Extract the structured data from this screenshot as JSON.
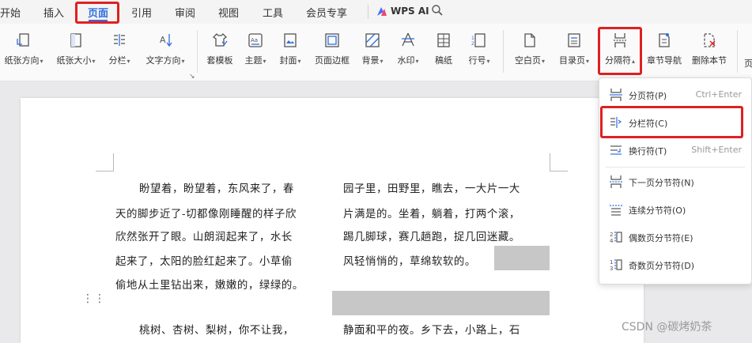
{
  "menubar": {
    "items": [
      "开始",
      "插入",
      "页面",
      "引用",
      "审阅",
      "视图",
      "工具",
      "会员专享"
    ],
    "active": "页面",
    "ai_label": "WPS AI"
  },
  "ribbon": {
    "groups": [
      {
        "label": "纸张方向",
        "icon": "page-orientation-icon",
        "dropdown": true
      },
      {
        "label": "纸张大小",
        "icon": "paper-size-icon",
        "dropdown": true
      },
      {
        "label": "分栏",
        "icon": "columns-icon",
        "dropdown": true
      },
      {
        "label": "文字方向",
        "icon": "text-direction-icon",
        "dropdown": true
      },
      {
        "label": "套模板",
        "icon": "template-shirt-icon",
        "dropdown": false
      },
      {
        "label": "主题",
        "icon": "theme-icon",
        "dropdown": true
      },
      {
        "label": "封面",
        "icon": "cover-page-icon",
        "dropdown": true
      },
      {
        "label": "页面边框",
        "icon": "page-border-icon",
        "dropdown": false
      },
      {
        "label": "背景",
        "icon": "background-icon",
        "dropdown": true
      },
      {
        "label": "水印",
        "icon": "watermark-icon",
        "dropdown": true
      },
      {
        "label": "稿纸",
        "icon": "manuscript-paper-icon",
        "dropdown": false
      },
      {
        "label": "行号",
        "icon": "line-number-icon",
        "dropdown": true
      },
      {
        "label": "空白页",
        "icon": "blank-page-icon",
        "dropdown": true
      },
      {
        "label": "目录页",
        "icon": "toc-page-icon",
        "dropdown": true
      },
      {
        "label": "分隔符",
        "icon": "break-icon",
        "dropdown": true
      },
      {
        "label": "章节导航",
        "icon": "section-nav-icon",
        "dropdown": false
      },
      {
        "label": "删除本节",
        "icon": "delete-section-icon",
        "dropdown": false
      }
    ],
    "edge_char": "页"
  },
  "document": {
    "left_column": [
      "盼望着，盼望着，东风来了，春",
      "天的脚步近了-切都像刚睡醒的样子欣",
      "欣然张开了眼。山朗润起来了，水长",
      "起来了，太阳的脸红起来了。小草偷",
      "偷地从土里钻出来，嫩嫩的，绿绿的。",
      "桃树、杏树、梨树，你不让我，"
    ],
    "right_column": [
      "园子里，田野里，瞧去，一大片一大",
      "片满是的。坐着，躺着，打两个滚，",
      "踢几脚球，赛几趟跑，捉几回迷藏。",
      "风轻悄悄的，草绵软软的。",
      "静面和平的夜。乡下去，小路上，石"
    ]
  },
  "dropdown": {
    "items": [
      {
        "label": "分页符(P)",
        "shortcut": "Ctrl+Enter",
        "icon": "page-break-icon"
      },
      {
        "label": "分栏符(C)",
        "shortcut": "",
        "icon": "column-break-icon"
      },
      {
        "label": "换行符(T)",
        "shortcut": "Shift+Enter",
        "icon": "line-break-icon"
      },
      {
        "label": "下一页分节符(N)",
        "shortcut": "",
        "icon": "next-page-section-icon"
      },
      {
        "label": "连续分节符(O)",
        "shortcut": "",
        "icon": "continuous-section-icon"
      },
      {
        "label": "偶数页分节符(E)",
        "shortcut": "",
        "icon": "even-page-section-icon"
      },
      {
        "label": "奇数页分节符(D)",
        "shortcut": "",
        "icon": "odd-page-section-icon"
      }
    ]
  },
  "watermark": "CSDN @碳烤奶茶",
  "colors": {
    "accent": "#2f6fe0",
    "highlight_border": "#e02020"
  }
}
